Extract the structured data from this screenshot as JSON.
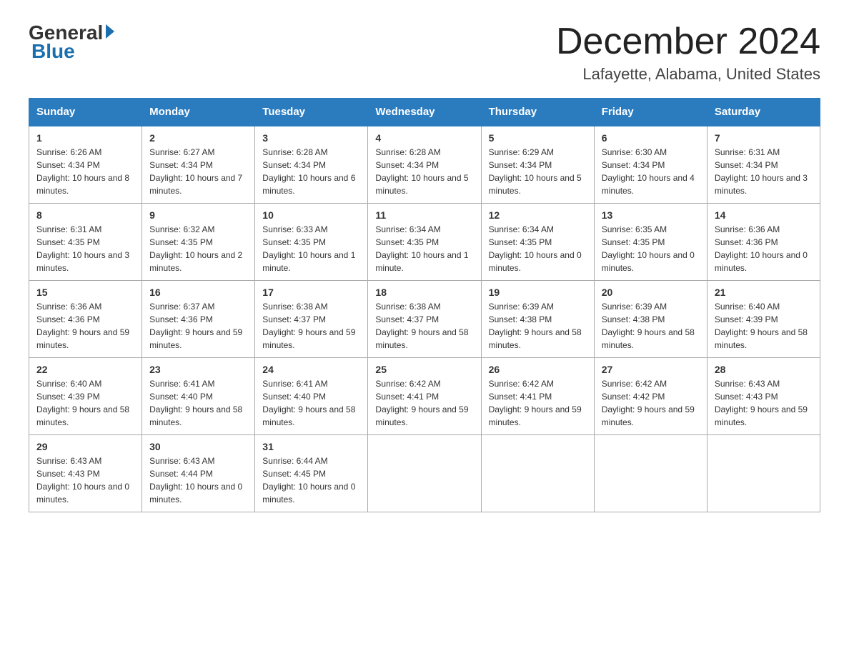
{
  "header": {
    "logo_general": "General",
    "logo_blue": "Blue",
    "month_title": "December 2024",
    "location": "Lafayette, Alabama, United States"
  },
  "weekdays": [
    "Sunday",
    "Monday",
    "Tuesday",
    "Wednesday",
    "Thursday",
    "Friday",
    "Saturday"
  ],
  "weeks": [
    [
      {
        "day": "1",
        "sunrise": "6:26 AM",
        "sunset": "4:34 PM",
        "daylight": "10 hours and 8 minutes."
      },
      {
        "day": "2",
        "sunrise": "6:27 AM",
        "sunset": "4:34 PM",
        "daylight": "10 hours and 7 minutes."
      },
      {
        "day": "3",
        "sunrise": "6:28 AM",
        "sunset": "4:34 PM",
        "daylight": "10 hours and 6 minutes."
      },
      {
        "day": "4",
        "sunrise": "6:28 AM",
        "sunset": "4:34 PM",
        "daylight": "10 hours and 5 minutes."
      },
      {
        "day": "5",
        "sunrise": "6:29 AM",
        "sunset": "4:34 PM",
        "daylight": "10 hours and 5 minutes."
      },
      {
        "day": "6",
        "sunrise": "6:30 AM",
        "sunset": "4:34 PM",
        "daylight": "10 hours and 4 minutes."
      },
      {
        "day": "7",
        "sunrise": "6:31 AM",
        "sunset": "4:34 PM",
        "daylight": "10 hours and 3 minutes."
      }
    ],
    [
      {
        "day": "8",
        "sunrise": "6:31 AM",
        "sunset": "4:35 PM",
        "daylight": "10 hours and 3 minutes."
      },
      {
        "day": "9",
        "sunrise": "6:32 AM",
        "sunset": "4:35 PM",
        "daylight": "10 hours and 2 minutes."
      },
      {
        "day": "10",
        "sunrise": "6:33 AM",
        "sunset": "4:35 PM",
        "daylight": "10 hours and 1 minute."
      },
      {
        "day": "11",
        "sunrise": "6:34 AM",
        "sunset": "4:35 PM",
        "daylight": "10 hours and 1 minute."
      },
      {
        "day": "12",
        "sunrise": "6:34 AM",
        "sunset": "4:35 PM",
        "daylight": "10 hours and 0 minutes."
      },
      {
        "day": "13",
        "sunrise": "6:35 AM",
        "sunset": "4:35 PM",
        "daylight": "10 hours and 0 minutes."
      },
      {
        "day": "14",
        "sunrise": "6:36 AM",
        "sunset": "4:36 PM",
        "daylight": "10 hours and 0 minutes."
      }
    ],
    [
      {
        "day": "15",
        "sunrise": "6:36 AM",
        "sunset": "4:36 PM",
        "daylight": "9 hours and 59 minutes."
      },
      {
        "day": "16",
        "sunrise": "6:37 AM",
        "sunset": "4:36 PM",
        "daylight": "9 hours and 59 minutes."
      },
      {
        "day": "17",
        "sunrise": "6:38 AM",
        "sunset": "4:37 PM",
        "daylight": "9 hours and 59 minutes."
      },
      {
        "day": "18",
        "sunrise": "6:38 AM",
        "sunset": "4:37 PM",
        "daylight": "9 hours and 58 minutes."
      },
      {
        "day": "19",
        "sunrise": "6:39 AM",
        "sunset": "4:38 PM",
        "daylight": "9 hours and 58 minutes."
      },
      {
        "day": "20",
        "sunrise": "6:39 AM",
        "sunset": "4:38 PM",
        "daylight": "9 hours and 58 minutes."
      },
      {
        "day": "21",
        "sunrise": "6:40 AM",
        "sunset": "4:39 PM",
        "daylight": "9 hours and 58 minutes."
      }
    ],
    [
      {
        "day": "22",
        "sunrise": "6:40 AM",
        "sunset": "4:39 PM",
        "daylight": "9 hours and 58 minutes."
      },
      {
        "day": "23",
        "sunrise": "6:41 AM",
        "sunset": "4:40 PM",
        "daylight": "9 hours and 58 minutes."
      },
      {
        "day": "24",
        "sunrise": "6:41 AM",
        "sunset": "4:40 PM",
        "daylight": "9 hours and 58 minutes."
      },
      {
        "day": "25",
        "sunrise": "6:42 AM",
        "sunset": "4:41 PM",
        "daylight": "9 hours and 59 minutes."
      },
      {
        "day": "26",
        "sunrise": "6:42 AM",
        "sunset": "4:41 PM",
        "daylight": "9 hours and 59 minutes."
      },
      {
        "day": "27",
        "sunrise": "6:42 AM",
        "sunset": "4:42 PM",
        "daylight": "9 hours and 59 minutes."
      },
      {
        "day": "28",
        "sunrise": "6:43 AM",
        "sunset": "4:43 PM",
        "daylight": "9 hours and 59 minutes."
      }
    ],
    [
      {
        "day": "29",
        "sunrise": "6:43 AM",
        "sunset": "4:43 PM",
        "daylight": "10 hours and 0 minutes."
      },
      {
        "day": "30",
        "sunrise": "6:43 AM",
        "sunset": "4:44 PM",
        "daylight": "10 hours and 0 minutes."
      },
      {
        "day": "31",
        "sunrise": "6:44 AM",
        "sunset": "4:45 PM",
        "daylight": "10 hours and 0 minutes."
      },
      null,
      null,
      null,
      null
    ]
  ]
}
